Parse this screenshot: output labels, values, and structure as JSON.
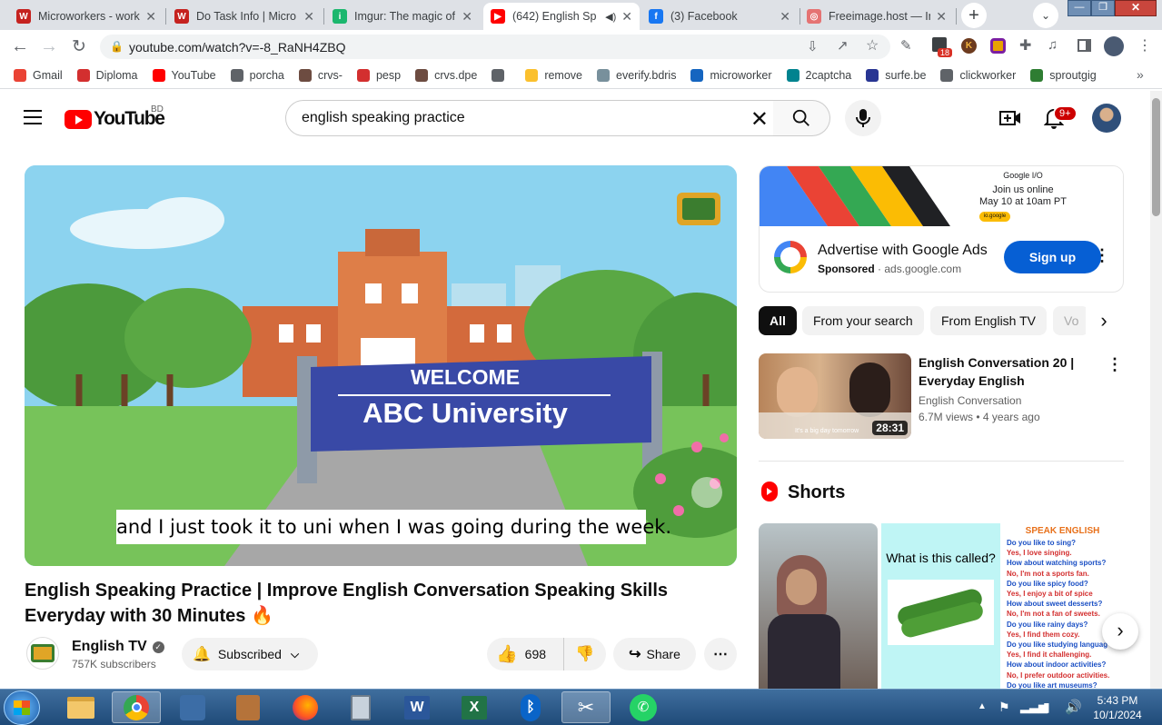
{
  "browser": {
    "tabs": [
      {
        "title": "Microworkers - work",
        "color": "#c5221f",
        "letter": "W"
      },
      {
        "title": "Do Task Info | Micro",
        "color": "#c5221f",
        "letter": "W"
      },
      {
        "title": "Imgur: The magic of",
        "color": "#1bb76e",
        "letter": "i"
      },
      {
        "title": "(642) English Sp",
        "color": "#ff0000",
        "letter": "▶"
      },
      {
        "title": "(3) Facebook",
        "color": "#1877f2",
        "letter": "f"
      },
      {
        "title": "Freeimage.host — In",
        "color": "#e57373",
        "letter": "◎"
      }
    ],
    "url": "youtube.com/watch?v=-8_RaNH4ZBQ",
    "extension_badge": "18",
    "bookmarks": [
      {
        "label": "Gmail",
        "color": "#ea4335"
      },
      {
        "label": "Diploma",
        "color": "#d32f2f"
      },
      {
        "label": "YouTube",
        "color": "#ff0000"
      },
      {
        "label": "porcha",
        "color": "#5f6368"
      },
      {
        "label": "crvs-",
        "color": "#6d4c41"
      },
      {
        "label": "pesp",
        "color": "#d32f2f"
      },
      {
        "label": "crvs.dpe",
        "color": "#6d4c41"
      },
      {
        "label": "",
        "color": "#5f6368"
      },
      {
        "label": "remove",
        "color": "#fbc02d"
      },
      {
        "label": "everify.bdris",
        "color": "#78909c"
      },
      {
        "label": "microworker",
        "color": "#1565c0"
      },
      {
        "label": "2captcha",
        "color": "#00838f"
      },
      {
        "label": "surfe.be",
        "color": "#283593"
      },
      {
        "label": "clickworker",
        "color": "#5f6368"
      },
      {
        "label": "sproutgig",
        "color": "#2e7d32"
      }
    ],
    "bookmarks_overflow": "»"
  },
  "youtube": {
    "logo_text": "YouTube",
    "country": "BD",
    "search_value": "english speaking practice",
    "notifications_badge": "9+",
    "video": {
      "caption": "and I just took it to uni when I was going during the week.",
      "sign_line1": "WELCOME",
      "sign_line2": "ABC University",
      "title": "English Speaking Practice | Improve English Conversation Speaking Skills Everyday with 30 Minutes 🔥",
      "channel_name": "English TV",
      "subscribers": "757K subscribers",
      "subscribed_label": "Subscribed",
      "likes": "698",
      "share_label": "Share"
    },
    "ad": {
      "banner_brand": "Google I/O",
      "banner_line1": "Join us online",
      "banner_line2": "May 10 at 10am PT",
      "banner_btn": "io.google",
      "title": "Advertise with Google Ads",
      "sponsored": "Sponsored",
      "domain": "ads.google.com",
      "cta": "Sign up"
    },
    "chips": [
      "All",
      "From your search",
      "From English TV",
      "Vo"
    ],
    "related": {
      "title_line1": "English Conversation 20 |",
      "title_line2": "Everyday English",
      "channel": "English Conversation",
      "views": "6.7M views",
      "age": "4 years ago",
      "duration": "28:31",
      "thumb_caption": "It's a big day tomorrow"
    },
    "shorts": {
      "heading": "Shorts",
      "card2_text": "What is this called?",
      "card3_heading": "SPEAK ENGLISH",
      "card3_lines": [
        "Do you like to sing?",
        "Yes, I love singing.",
        "How about watching sports?",
        "No, I'm not a sports fan.",
        "Do you like spicy food?",
        "Yes, I enjoy a bit of spice",
        "How about sweet desserts?",
        "No, I'm not a fan of sweets.",
        "Do you like rainy days?",
        "Yes, I find them cozy.",
        "Do you like studying languag",
        "Yes, I find it challenging.",
        "How about indoor activities?",
        "No, I prefer outdoor activities.",
        "Do you like art museums?"
      ]
    }
  },
  "taskbar": {
    "time": "5:43 PM",
    "date": "10/1/2024"
  }
}
